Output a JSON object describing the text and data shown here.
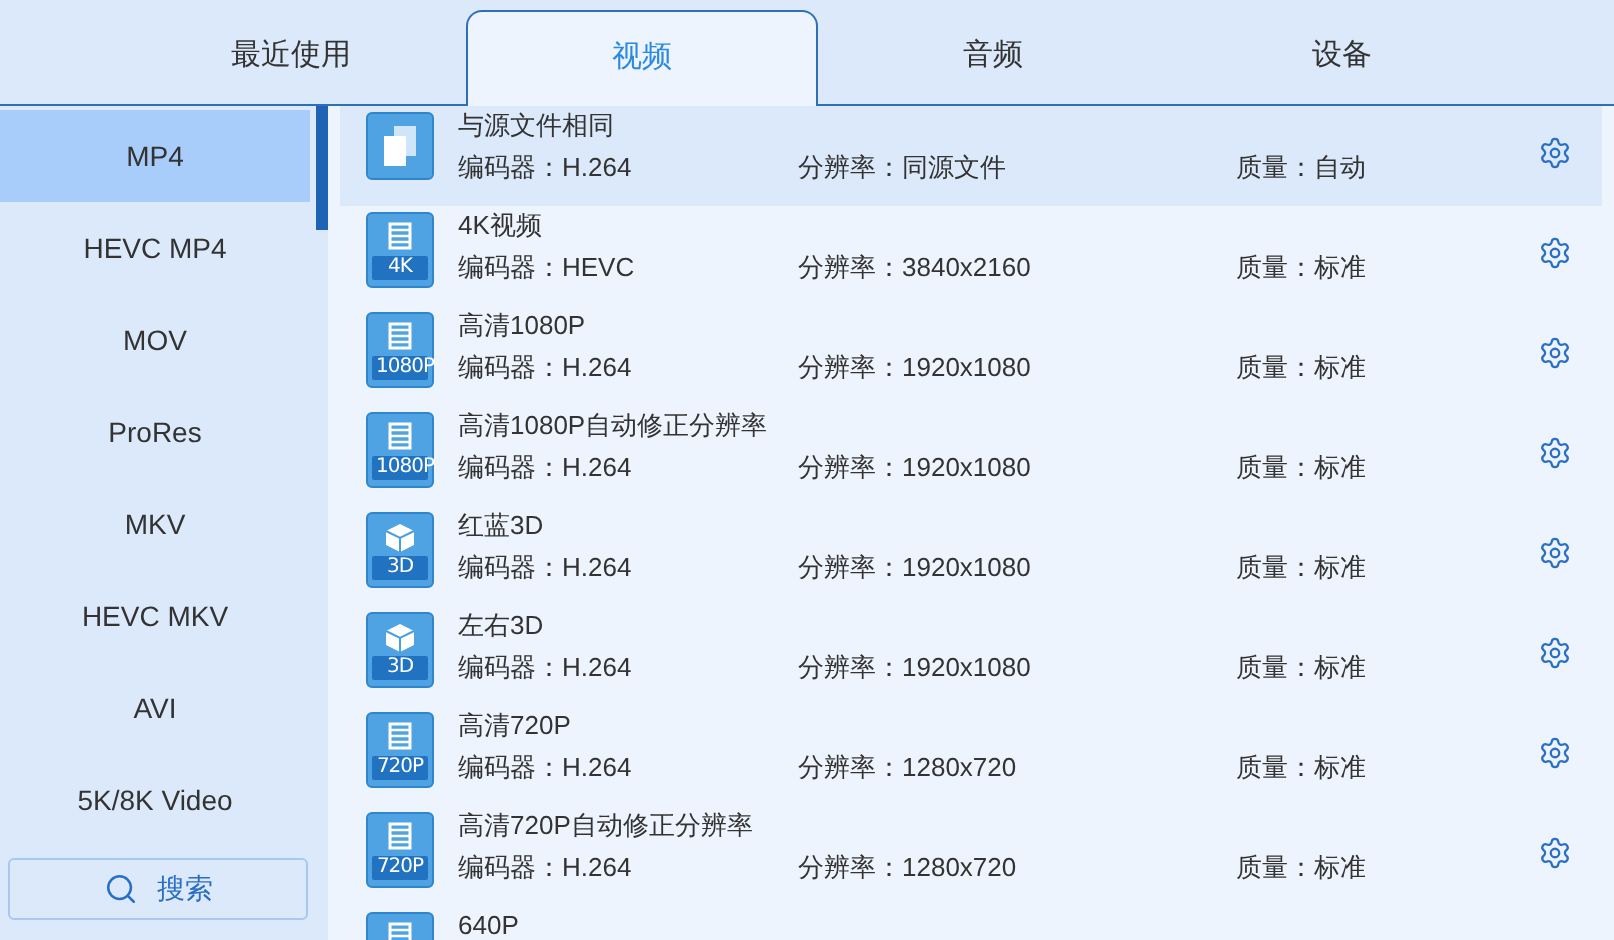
{
  "tabs": [
    {
      "label": "最近使用",
      "selected": false
    },
    {
      "label": "视频",
      "selected": true
    },
    {
      "label": "音频",
      "selected": false
    },
    {
      "label": "设备",
      "selected": false
    }
  ],
  "sidebar": {
    "items": [
      {
        "label": "MP4",
        "selected": true
      },
      {
        "label": "HEVC MP4",
        "selected": false
      },
      {
        "label": "MOV",
        "selected": false
      },
      {
        "label": "ProRes",
        "selected": false
      },
      {
        "label": "MKV",
        "selected": false
      },
      {
        "label": "HEVC MKV",
        "selected": false
      },
      {
        "label": "AVI",
        "selected": false
      },
      {
        "label": "5K/8K Video",
        "selected": false
      }
    ],
    "search_button": "搜索"
  },
  "presets": [
    {
      "kind": "copy",
      "title": "与源文件相同",
      "codec": "编码器：H.264",
      "resolution": "分辨率：同源文件",
      "quality": "质量：自动",
      "selected": true
    },
    {
      "kind": "film",
      "badge": "4K",
      "title": "4K视频",
      "codec": "编码器：HEVC",
      "resolution": "分辨率：3840x2160",
      "quality": "质量：标准",
      "selected": false
    },
    {
      "kind": "film",
      "badge": "1080P",
      "title": "高清1080P",
      "codec": "编码器：H.264",
      "resolution": "分辨率：1920x1080",
      "quality": "质量：标准",
      "selected": false
    },
    {
      "kind": "film",
      "badge": "1080P",
      "title": "高清1080P自动修正分辨率",
      "codec": "编码器：H.264",
      "resolution": "分辨率：1920x1080",
      "quality": "质量：标准",
      "selected": false
    },
    {
      "kind": "cube",
      "badge": "3D",
      "title": "红蓝3D",
      "codec": "编码器：H.264",
      "resolution": "分辨率：1920x1080",
      "quality": "质量：标准",
      "selected": false
    },
    {
      "kind": "cube",
      "badge": "3D",
      "title": "左右3D",
      "codec": "编码器：H.264",
      "resolution": "分辨率：1920x1080",
      "quality": "质量：标准",
      "selected": false
    },
    {
      "kind": "film",
      "badge": "720P",
      "title": "高清720P",
      "codec": "编码器：H.264",
      "resolution": "分辨率：1280x720",
      "quality": "质量：标准",
      "selected": false
    },
    {
      "kind": "film",
      "badge": "720P",
      "title": "高清720P自动修正分辨率",
      "codec": "编码器：H.264",
      "resolution": "分辨率：1280x720",
      "quality": "质量：标准",
      "selected": false
    },
    {
      "kind": "film",
      "title": "640P",
      "selected": false
    }
  ]
}
